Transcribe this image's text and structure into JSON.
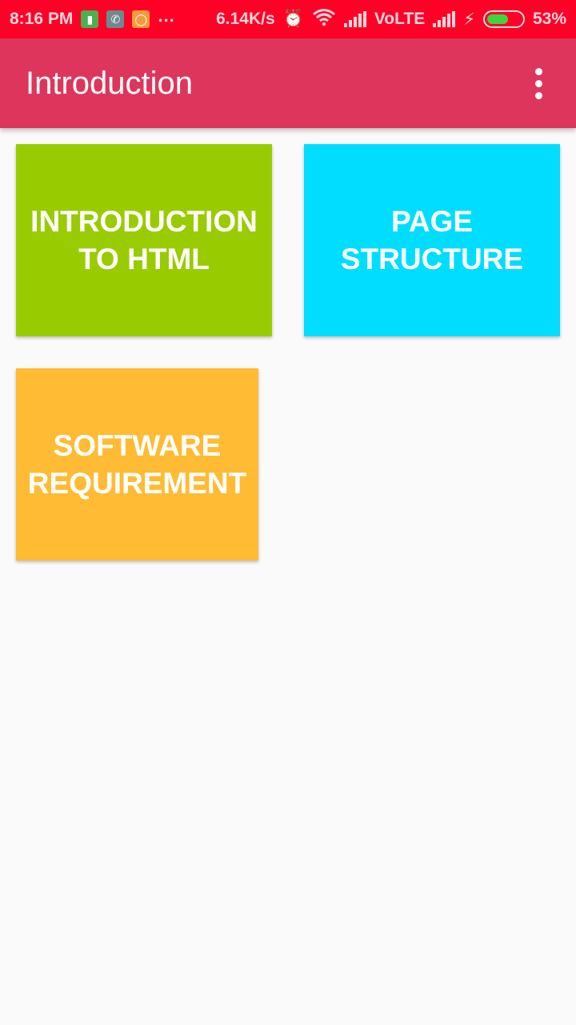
{
  "status_bar": {
    "time": "8:16 PM",
    "more": "...",
    "net_speed": "6.14K/s",
    "network": "VoLTE",
    "battery": "53%",
    "battery_level": 0.53
  },
  "app_bar": {
    "title": "Introduction"
  },
  "tiles": [
    {
      "label": "INTRODUCTION TO HTML",
      "color": "#99cc00"
    },
    {
      "label": "PAGE STRUCTURE",
      "color": "#00ddff"
    },
    {
      "label": "SOFTWARE REQUIREMENT",
      "color": "#ffbb33"
    }
  ],
  "colors": {
    "status_bar": "#ff0026",
    "app_bar": "#de355c",
    "background": "#fafafa"
  }
}
